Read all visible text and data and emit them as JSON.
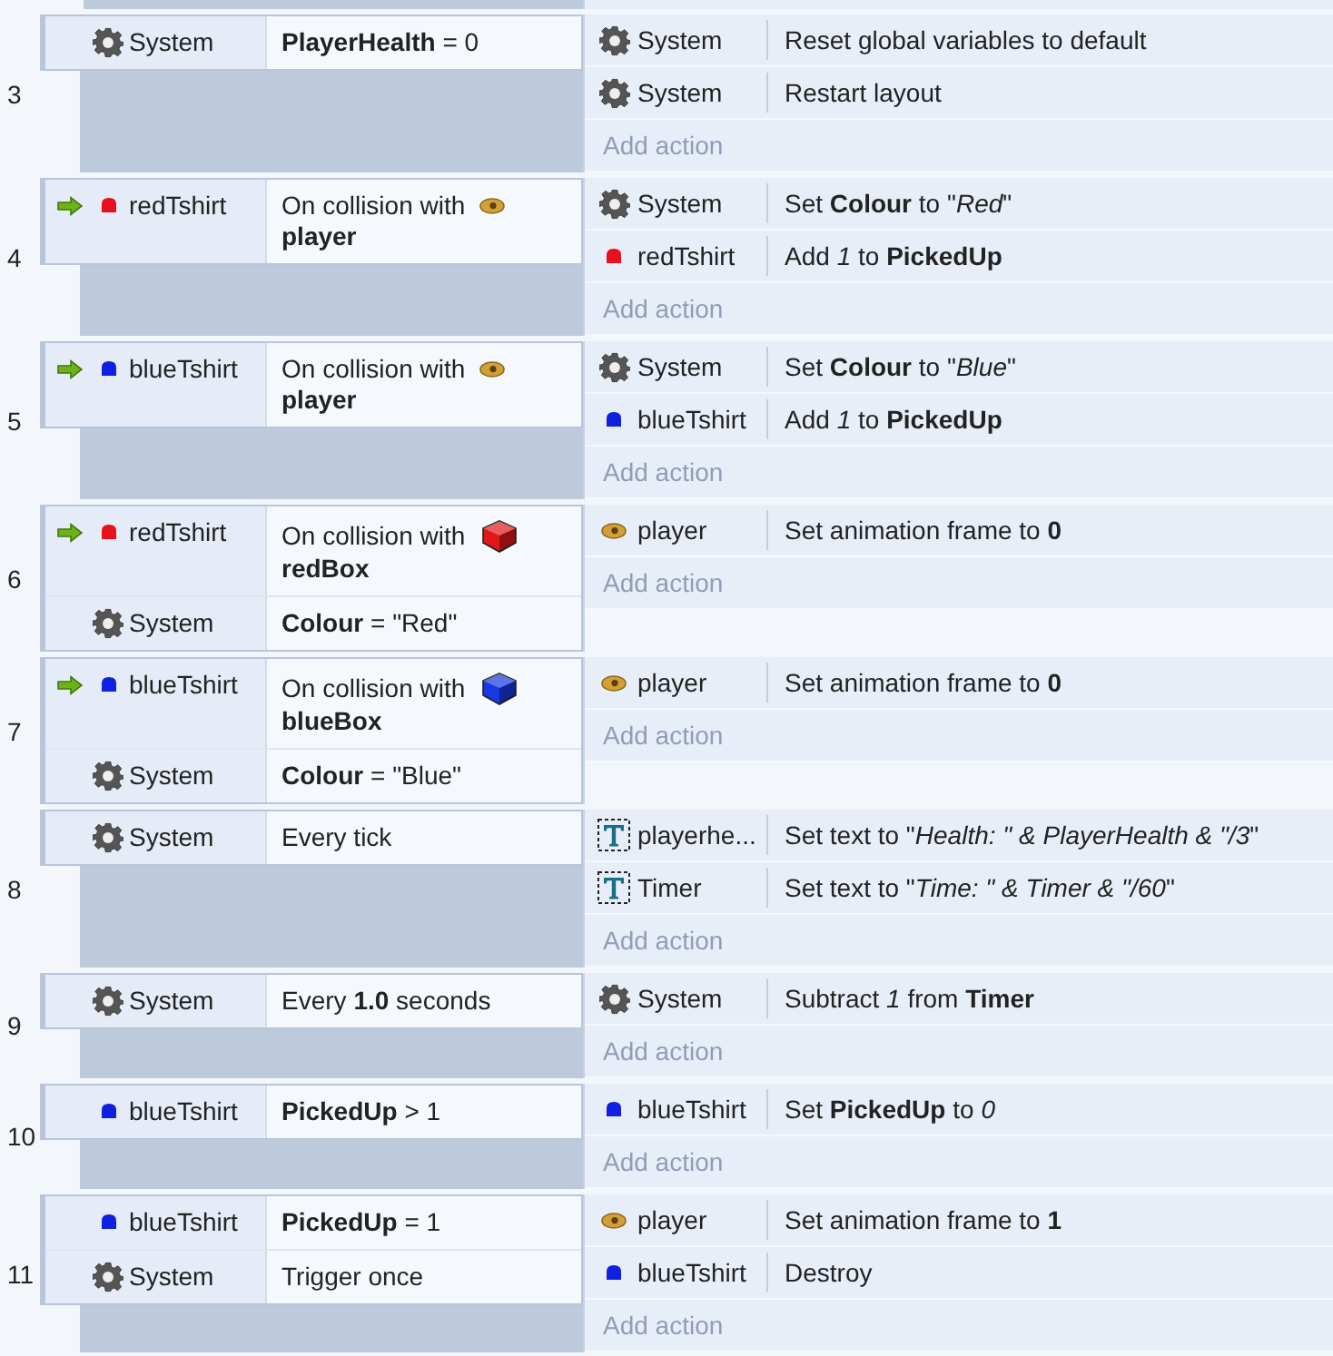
{
  "events": [
    {
      "number": "3",
      "conditions": [
        {
          "trigger": false,
          "object": {
            "name": "System",
            "kind": "gear"
          },
          "text": "**PlayerHealth** = 0"
        }
      ],
      "actions": [
        {
          "object": {
            "name": "System",
            "kind": "gear"
          },
          "text": "Reset global variables to default"
        },
        {
          "object": {
            "name": "System",
            "kind": "gear"
          },
          "text": "Restart layout"
        }
      ],
      "add_action": "Add action"
    },
    {
      "number": "4",
      "conditions": [
        {
          "trigger": true,
          "object": {
            "name": "redTshirt",
            "kind": "dot",
            "color": "#e8101a"
          },
          "text": "On collision with",
          "target": {
            "name": "player",
            "kind": "player"
          }
        }
      ],
      "actions": [
        {
          "object": {
            "name": "System",
            "kind": "gear"
          },
          "text": "Set **Colour** to \"*Red*\""
        },
        {
          "object": {
            "name": "redTshirt",
            "kind": "dot",
            "color": "#e8101a"
          },
          "text": "Add *1* to **PickedUp**"
        }
      ],
      "add_action": "Add action"
    },
    {
      "number": "5",
      "conditions": [
        {
          "trigger": true,
          "object": {
            "name": "blueTshirt",
            "kind": "dot",
            "color": "#1020e0"
          },
          "text": "On collision with",
          "target": {
            "name": "player",
            "kind": "player"
          }
        }
      ],
      "actions": [
        {
          "object": {
            "name": "System",
            "kind": "gear"
          },
          "text": "Set **Colour** to \"*Blue*\""
        },
        {
          "object": {
            "name": "blueTshirt",
            "kind": "dot",
            "color": "#1020e0"
          },
          "text": "Add *1* to **PickedUp**"
        }
      ],
      "add_action": "Add action"
    },
    {
      "number": "6",
      "conditions": [
        {
          "trigger": true,
          "object": {
            "name": "redTshirt",
            "kind": "dot",
            "color": "#e8101a"
          },
          "text": "On collision with",
          "target": {
            "name": "redBox",
            "kind": "box",
            "color": "#e01818"
          }
        },
        {
          "trigger": false,
          "object": {
            "name": "System",
            "kind": "gear"
          },
          "text": "**Colour** = \"Red\""
        }
      ],
      "actions": [
        {
          "object": {
            "name": "player",
            "kind": "player"
          },
          "text": "Set animation frame to **0**"
        }
      ],
      "add_action": "Add action"
    },
    {
      "number": "7",
      "conditions": [
        {
          "trigger": true,
          "object": {
            "name": "blueTshirt",
            "kind": "dot",
            "color": "#1020e0"
          },
          "text": "On collision with",
          "target": {
            "name": "blueBox",
            "kind": "box",
            "color": "#1838e0"
          }
        },
        {
          "trigger": false,
          "object": {
            "name": "System",
            "kind": "gear"
          },
          "text": "**Colour** = \"Blue\""
        }
      ],
      "actions": [
        {
          "object": {
            "name": "player",
            "kind": "player"
          },
          "text": "Set animation frame to **0**"
        }
      ],
      "add_action": "Add action"
    },
    {
      "number": "8",
      "conditions": [
        {
          "trigger": false,
          "object": {
            "name": "System",
            "kind": "gear"
          },
          "text": "Every tick"
        }
      ],
      "actions": [
        {
          "object": {
            "name": "playerhe...",
            "kind": "text"
          },
          "text": "Set text to \"*Health: \" & PlayerHealth & \"/3*\""
        },
        {
          "object": {
            "name": "Timer",
            "kind": "text"
          },
          "text": "Set text to \"*Time: \" & Timer & \"/60*\""
        }
      ],
      "add_action": "Add action"
    },
    {
      "number": "9",
      "conditions": [
        {
          "trigger": false,
          "object": {
            "name": "System",
            "kind": "gear"
          },
          "text": "Every **1.0** seconds"
        }
      ],
      "actions": [
        {
          "object": {
            "name": "System",
            "kind": "gear"
          },
          "text": "Subtract *1* from **Timer**"
        }
      ],
      "add_action": "Add action"
    },
    {
      "number": "10",
      "conditions": [
        {
          "trigger": false,
          "object": {
            "name": "blueTshirt",
            "kind": "dot",
            "color": "#1020e0"
          },
          "text": "**PickedUp** > 1"
        }
      ],
      "actions": [
        {
          "object": {
            "name": "blueTshirt",
            "kind": "dot",
            "color": "#1020e0"
          },
          "text": "Set **PickedUp** to *0*"
        }
      ],
      "add_action": "Add action"
    },
    {
      "number": "11",
      "conditions": [
        {
          "trigger": false,
          "object": {
            "name": "blueTshirt",
            "kind": "dot",
            "color": "#1020e0"
          },
          "text": "**PickedUp** = 1"
        },
        {
          "trigger": false,
          "object": {
            "name": "System",
            "kind": "gear"
          },
          "text": "Trigger once"
        }
      ],
      "actions": [
        {
          "object": {
            "name": "player",
            "kind": "player"
          },
          "text": "Set animation frame to **1**"
        },
        {
          "object": {
            "name": "blueTshirt",
            "kind": "dot",
            "color": "#1020e0"
          },
          "text": "Destroy"
        }
      ],
      "add_action": "Add action"
    }
  ]
}
